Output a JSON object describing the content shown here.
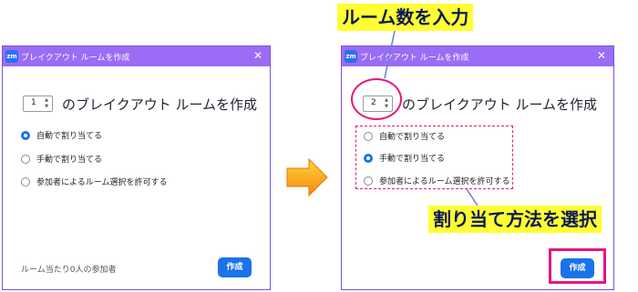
{
  "left_dialog": {
    "title": "ブレイクアウト ルームを作成",
    "logo": "zm",
    "room_count": "1",
    "heading": "のブレイクアウト ルームを作成",
    "options": [
      {
        "label": "自動で割り当てる",
        "checked": true
      },
      {
        "label": "手動で割り当てる",
        "checked": false
      },
      {
        "label": "参加者によるルーム選択を許可する",
        "checked": false
      }
    ],
    "footer": "ルーム当たり0人の参加者",
    "create_button": "作成"
  },
  "right_dialog": {
    "title": "ブレイクアウト ルームを作成",
    "logo": "zm",
    "room_count": "2",
    "heading": "のブレイクアウト ルームを作成",
    "options": [
      {
        "label": "自動で割り当てる",
        "checked": false
      },
      {
        "label": "手動で割り当てる",
        "checked": true
      },
      {
        "label": "参加者によるルーム選択を許可する",
        "checked": false
      }
    ],
    "create_button": "作成"
  },
  "annotations": {
    "enter_room_count": "ルーム数を入力",
    "select_assign_method": "割り当て方法を選択"
  },
  "colors": {
    "titlebar": "#9b6cf5",
    "accent": "#1a73e8",
    "highlight": "#e8157f",
    "callout_bg": "#ffff33",
    "arrow": "#f7a21b"
  }
}
